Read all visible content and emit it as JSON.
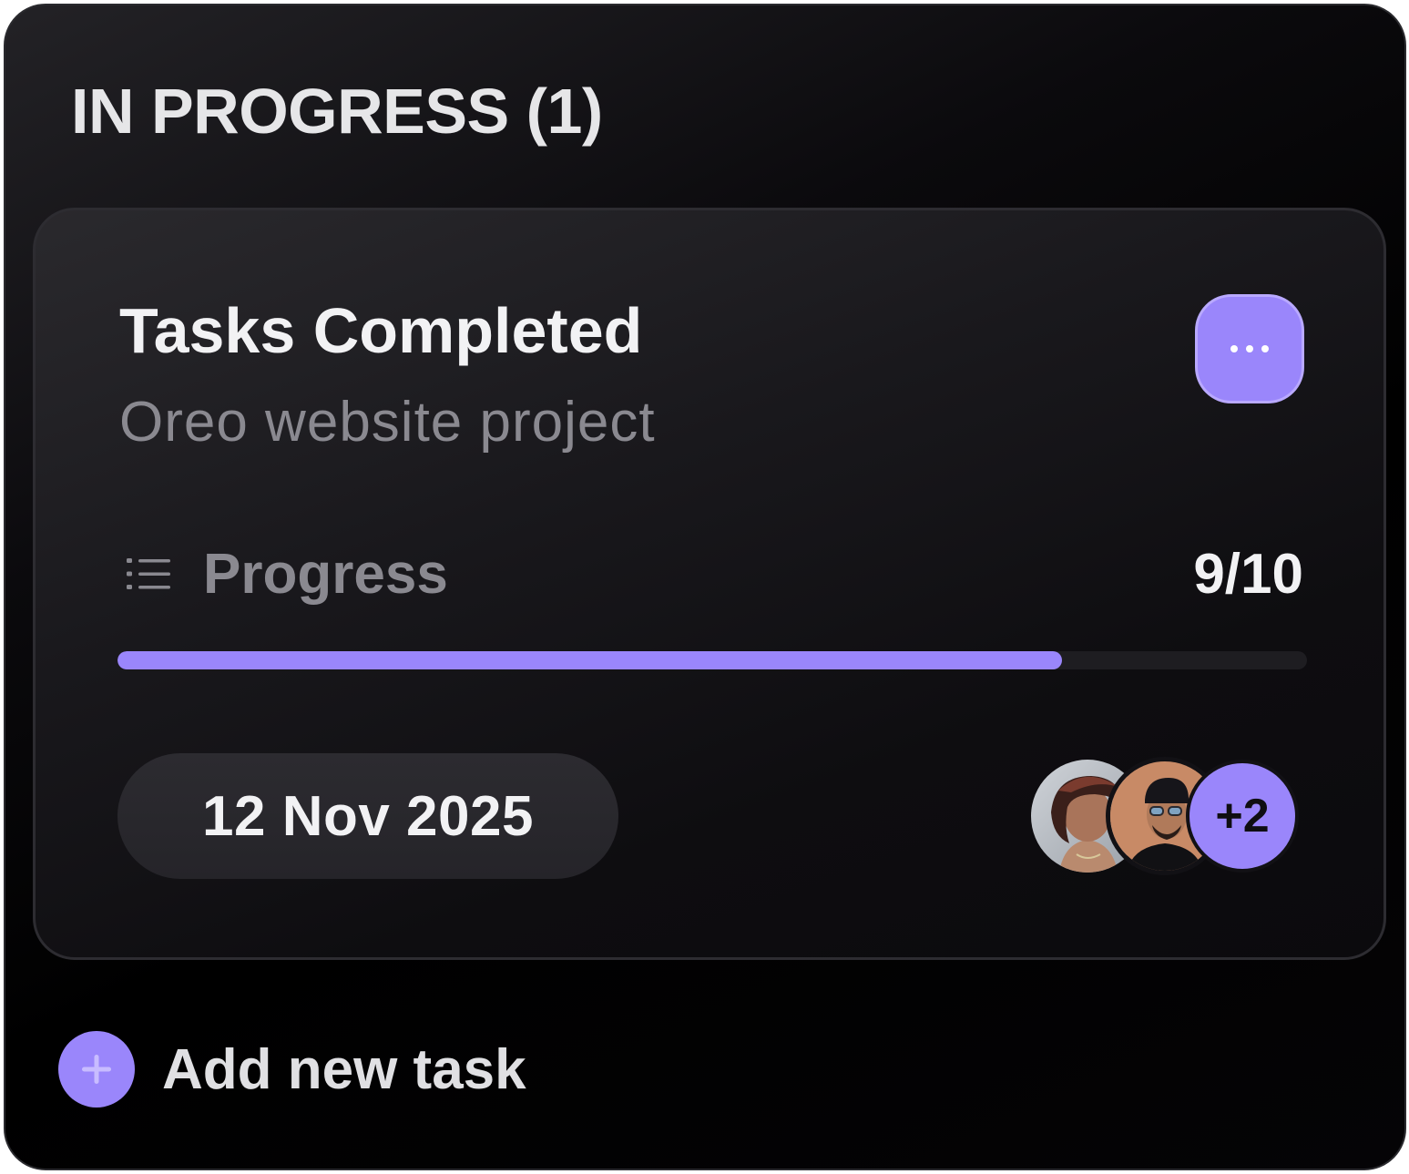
{
  "column": {
    "title": "IN PROGRESS (1)"
  },
  "card": {
    "title": "Tasks Completed",
    "subtitle": "Oreo website project",
    "more_button_icon": "more-horizontal-icon",
    "progress": {
      "icon": "list-icon",
      "label": "Progress",
      "count_text": "9/10",
      "completed": 9,
      "total": 10
    },
    "due_date": "12 Nov 2025",
    "assignees": {
      "avatars": [
        "avatar-person-1",
        "avatar-person-2"
      ],
      "more_count": "+2"
    }
  },
  "add_task": {
    "icon": "plus-icon",
    "label": "Add new task"
  },
  "colors": {
    "accent": "#9a86fb",
    "background": "#000000",
    "card": "#19181c",
    "text_primary": "#f2f2f4",
    "text_secondary": "#8a8990"
  }
}
